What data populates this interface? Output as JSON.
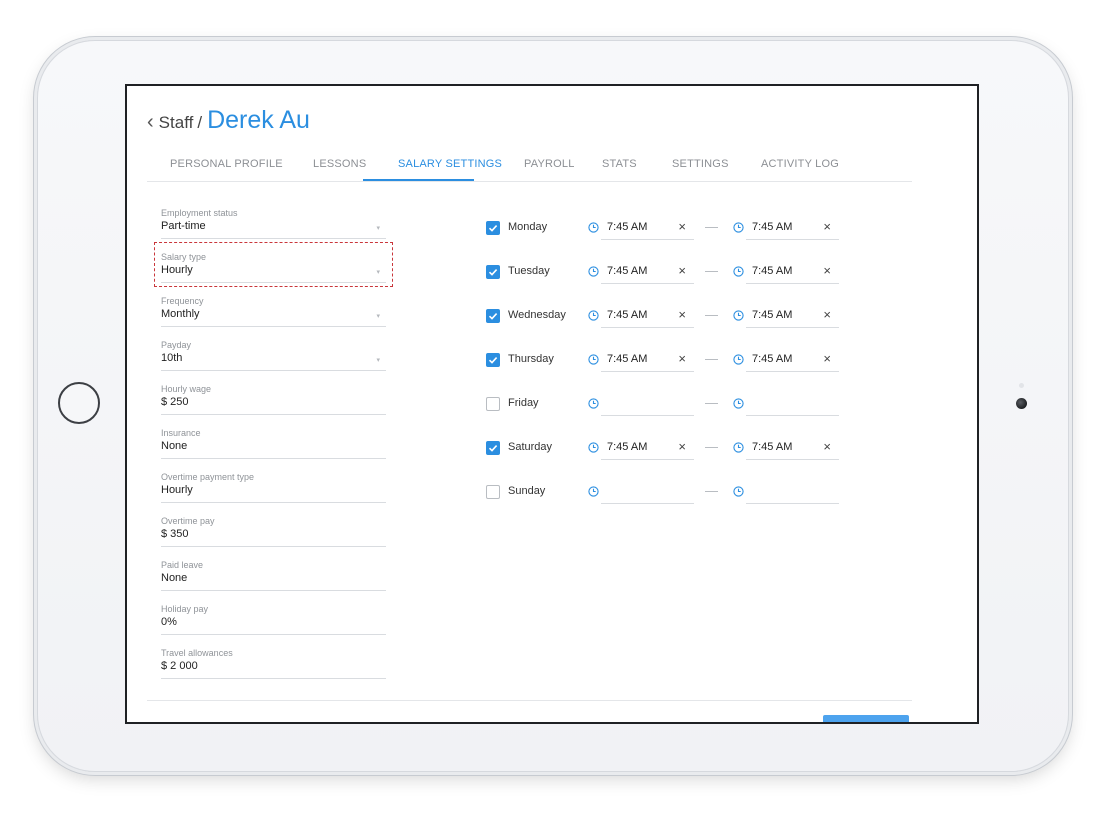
{
  "header": {
    "back_icon": "chevron-left-icon",
    "parent": "Staff",
    "separator": "/",
    "name": "Derek Au"
  },
  "tabs": [
    {
      "label": "PERSONAL PROFILE",
      "active": false
    },
    {
      "label": "LESSONS",
      "active": false
    },
    {
      "label": "SALARY SETTINGS",
      "active": true
    },
    {
      "label": "PAYROLL",
      "active": false
    },
    {
      "label": "STATS",
      "active": false
    },
    {
      "label": "SETTINGS",
      "active": false
    },
    {
      "label": "ACTIVITY LOG",
      "active": false
    }
  ],
  "fields": [
    {
      "label": "Employment status",
      "value": "Part-time",
      "dropdown": true
    },
    {
      "label": "Salary type",
      "value": "Hourly",
      "dropdown": true
    },
    {
      "label": "Frequency",
      "value": "Monthly",
      "dropdown": true
    },
    {
      "label": "Payday",
      "value": "10th",
      "dropdown": true
    },
    {
      "label": "Hourly wage",
      "value": "$ 250",
      "dropdown": false
    },
    {
      "label": "Insurance",
      "value": "None",
      "dropdown": false
    },
    {
      "label": "Overtime payment type",
      "value": "Hourly",
      "dropdown": false
    },
    {
      "label": "Overtime pay",
      "value": "$ 350",
      "dropdown": false
    },
    {
      "label": "Paid leave",
      "value": "None",
      "dropdown": false
    },
    {
      "label": "Holiday pay",
      "value": "0%",
      "dropdown": false
    },
    {
      "label": "Travel allowances",
      "value": "$ 2 000",
      "dropdown": false
    }
  ],
  "schedule": [
    {
      "day": "Monday",
      "checked": true,
      "start": "7:45 AM",
      "end": "7:45 AM"
    },
    {
      "day": "Tuesday",
      "checked": true,
      "start": "7:45 AM",
      "end": "7:45 AM"
    },
    {
      "day": "Wednesday",
      "checked": true,
      "start": "7:45 AM",
      "end": "7:45 AM"
    },
    {
      "day": "Thursday",
      "checked": true,
      "start": "7:45 AM",
      "end": "7:45 AM"
    },
    {
      "day": "Friday",
      "checked": false,
      "start": "",
      "end": ""
    },
    {
      "day": "Saturday",
      "checked": true,
      "start": "7:45 AM",
      "end": "7:45 AM"
    },
    {
      "day": "Sunday",
      "checked": false,
      "start": "",
      "end": ""
    }
  ],
  "clear_glyph": "×",
  "caret_glyph": "▾",
  "colors": {
    "accent": "#2b8ee0",
    "highlight_border": "#c9363b",
    "save_button": "#4da3ee"
  },
  "icons": {
    "clock": "clock-icon",
    "check": "check-icon",
    "clear": "close-icon",
    "caret": "chevron-down-icon"
  }
}
